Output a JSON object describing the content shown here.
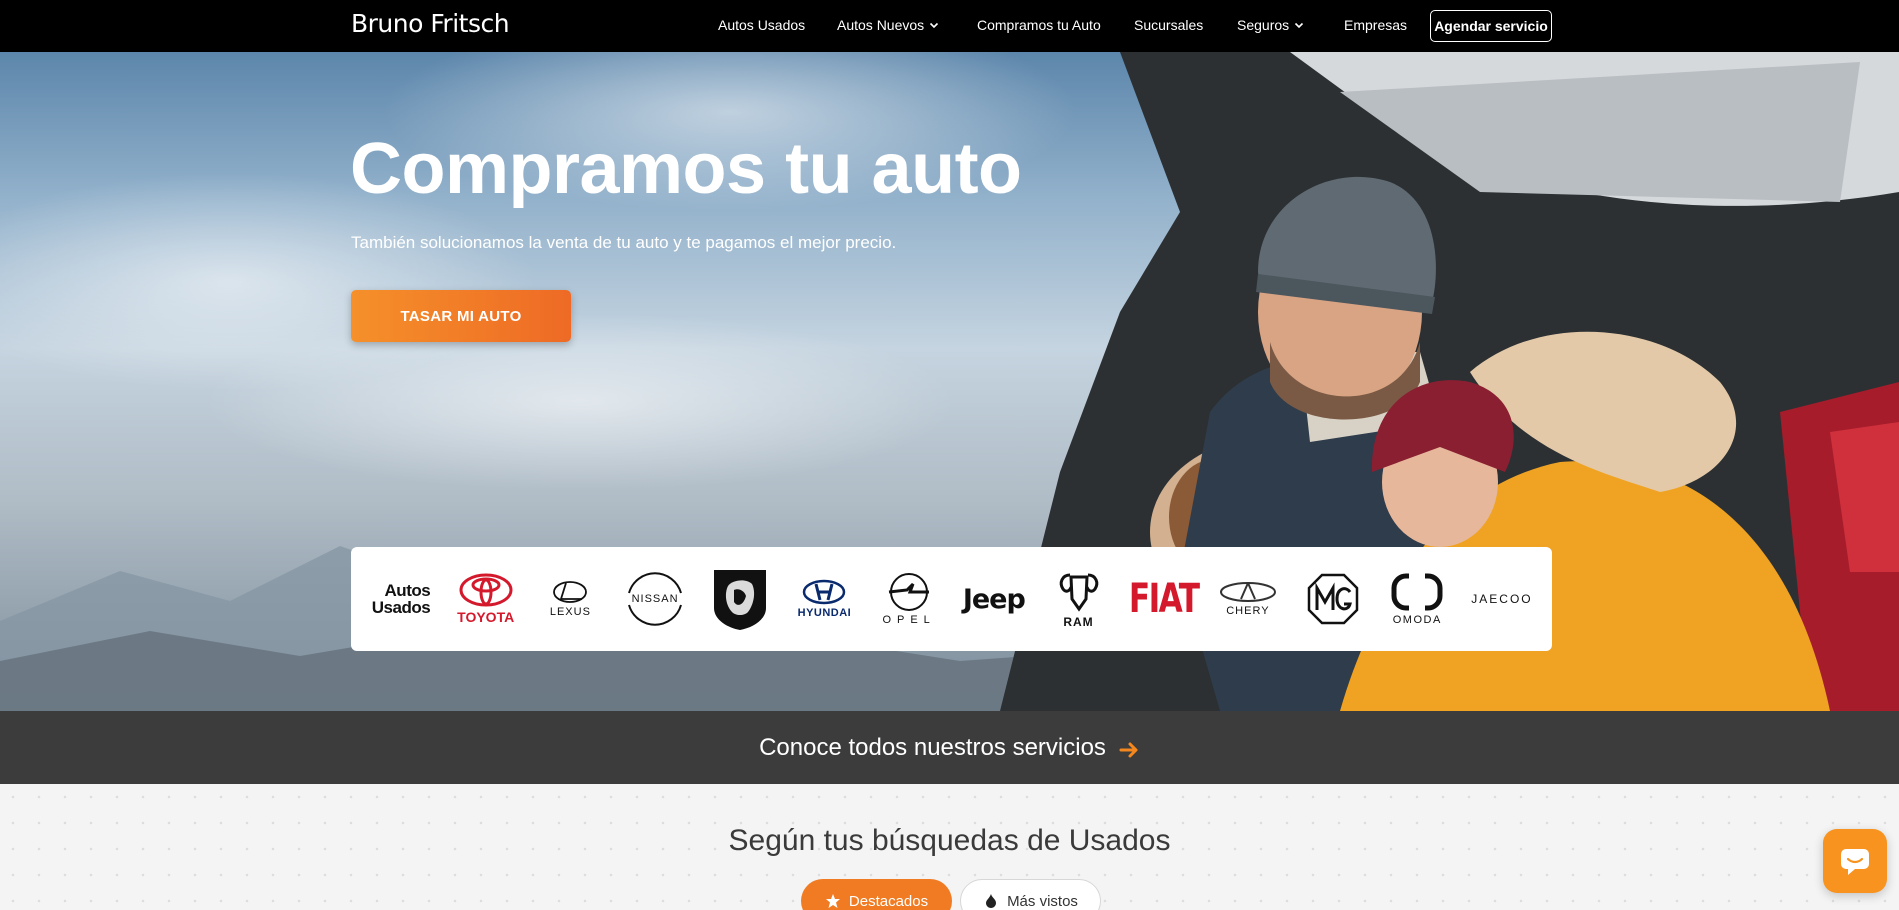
{
  "nav": {
    "brand": "Bruno Fritsch",
    "items": [
      {
        "label": "Autos Usados",
        "dropdown": false
      },
      {
        "label": "Autos Nuevos",
        "dropdown": true
      },
      {
        "label": "Compramos tu Auto",
        "dropdown": false
      },
      {
        "label": "Sucursales",
        "dropdown": false
      },
      {
        "label": "Seguros",
        "dropdown": true
      },
      {
        "label": "Empresas",
        "dropdown": false
      }
    ],
    "cta": "Agendar servicio"
  },
  "hero": {
    "title": "Compramos tu auto",
    "subtitle": "También solucionamos la venta de tu auto y te pagamos el mejor precio.",
    "button": "TASAR MI AUTO"
  },
  "brands": {
    "usados_line1": "Autos",
    "usados_line2": "Usados",
    "toyota": "TOYOTA",
    "lexus": "LEXUS",
    "nissan": "NISSAN",
    "hyundai": "HYUNDAI",
    "opel": "OPEL",
    "jeep": "Jeep",
    "ram": "RAM",
    "fiat": "FIAT",
    "chery": "CHERY",
    "omoda": "OMODA",
    "jaecoo": "JAECOO"
  },
  "services_bar": {
    "label": "Conoce todos nuestros servicios"
  },
  "section": {
    "title": "Según tus búsquedas de Usados",
    "tabs": [
      "Destacados",
      "Más vistos"
    ]
  },
  "colors": {
    "accent": "#f07b22",
    "nav_bg": "#000000",
    "services_bg": "#3c3c3c"
  },
  "icons": {
    "nav_dropdown": "chevron-down-icon",
    "services": "arrow-right-icon",
    "chat": "chat-icon"
  }
}
